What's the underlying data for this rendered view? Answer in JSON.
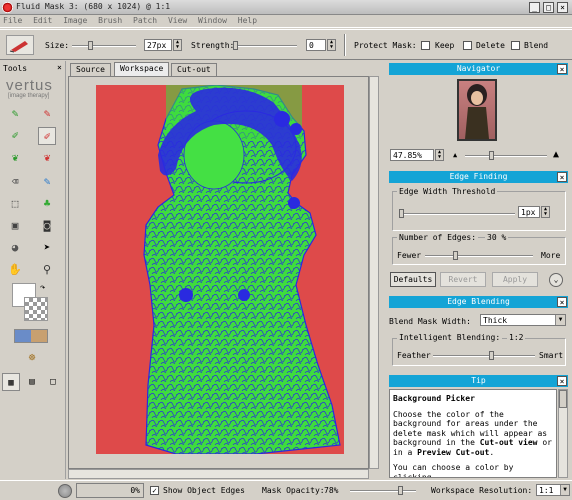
{
  "window": {
    "title": "Fluid Mask 3:  (680 x 1024) @ 1:1"
  },
  "menu": [
    "File",
    "Edit",
    "Image",
    "Brush",
    "Patch",
    "View",
    "Window",
    "Help"
  ],
  "toolbar": {
    "size_label": "Size:",
    "size_value": "27px",
    "strength_label": "Strength:",
    "strength_value": "0",
    "protect_label": "Protect Mask:",
    "keep_label": "Keep",
    "delete_label": "Delete",
    "blend_label": "Blend"
  },
  "tools": {
    "title": "Tools",
    "brand": "vertus",
    "brand_sub": "[image therapy]"
  },
  "tabs": [
    "Source",
    "Workspace",
    "Cut-out"
  ],
  "navigator": {
    "title": "Navigator",
    "zoom": "47.85%"
  },
  "edge_finding": {
    "title": "Edge Finding",
    "threshold_label": "Edge Width Threshold",
    "threshold_value": "1px",
    "edges_label": "Number of Edges:",
    "edges_value": "30 %",
    "fewer": "Fewer",
    "more": "More",
    "defaults_btn": "Defaults",
    "revert_btn": "Revert",
    "apply_btn": "Apply"
  },
  "edge_blending": {
    "title": "Edge Blending",
    "mask_width_label": "Blend Mask Width:",
    "mask_width_value": "Thick",
    "intelligent_label": "Intelligent Blending:",
    "intelligent_value": "1:2",
    "feather": "Feather",
    "smart": "Smart"
  },
  "tip": {
    "title": "Tip",
    "heading": "Background Picker",
    "body_1": "Choose the color of the background for areas under the delete mask which will appear as background in the ",
    "cutout_view": "Cut-out view",
    "body_2": " or in a ",
    "preview_cutout": "Preview Cut-out",
    "body_3": ".",
    "body_4": "You can choose a color by clicking"
  },
  "status": {
    "progress": "0%",
    "show_edges_label": "Show Object Edges",
    "mask_opacity_label": "Mask Opacity:",
    "mask_opacity_value": "78%",
    "resolution_label": "Workspace Resolution:",
    "resolution_value": "1:1"
  },
  "colors": {
    "accent": "#14a4d6",
    "background_red": "#de4a4a",
    "keep_green": "#3edc3e",
    "edge_blue": "#2a2ae0"
  }
}
